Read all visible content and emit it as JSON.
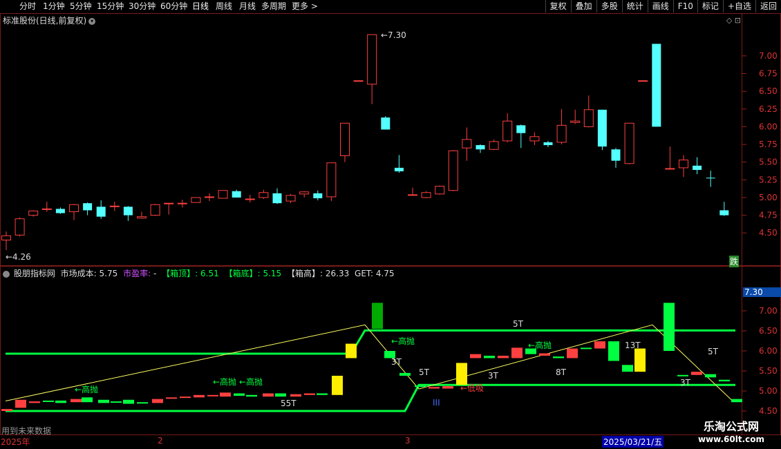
{
  "toolbar": {
    "intervals": [
      "分时",
      "1分钟",
      "5分钟",
      "15分钟",
      "30分钟",
      "60分钟",
      "日线",
      "周线",
      "月线",
      "多周期",
      "更多 >"
    ],
    "active_interval": "日线",
    "right_buttons": [
      "复权",
      "叠加",
      "多股",
      "统计",
      "画线",
      "F10",
      "标记",
      "+自选",
      "返回"
    ]
  },
  "price_panel": {
    "title": "标准股份(日线,前复权)",
    "high_marker": "7.30",
    "low_marker": "4.26",
    "fall_badge": "跌",
    "axis_ticks": [
      "7.00",
      "6.75",
      "6.50",
      "6.25",
      "6.00",
      "5.75",
      "5.50",
      "5.25",
      "5.00",
      "4.75",
      "4.50"
    ]
  },
  "indicator_panel": {
    "title_name": "股朋指标网",
    "cost_label": "市场成本:",
    "cost_value": "5.75",
    "pe_label": "市盈率:",
    "pe_value": "-",
    "top_label": "【箱顶】:",
    "top_value": "6.51",
    "bottom_label": "【箱底】:",
    "bottom_value": "5.15",
    "height_label": "【箱高】:",
    "height_value": "26.33",
    "get_label": "GET:",
    "get_value": "4.75",
    "current_price": "7.30",
    "axis_ticks": [
      "7.00",
      "6.50",
      "6.00",
      "5.50",
      "5.00",
      "4.50"
    ],
    "annotations": [
      "←高抛",
      "←高抛",
      "←高抛",
      "←高抛",
      "←高抛",
      "←低吸",
      "55T",
      "3T",
      "5T",
      "3T",
      "5T",
      "8T",
      "13T",
      "5T",
      "3T",
      "III"
    ],
    "future_note": "用到未来数据"
  },
  "date_axis": {
    "labels": [
      "2025年",
      "2",
      "3"
    ],
    "selected_date": "2025/03/21/五"
  },
  "watermark": {
    "name": "乐淘公式网",
    "url": "www.60lt.com"
  },
  "colors": {
    "up": "#ff4040",
    "down": "#54ffff",
    "indicator_green": "#00ff40",
    "yellow_line": "#ffff60",
    "frame": "#7a1a1a"
  },
  "chart_data": [
    {
      "type": "candlestick",
      "title": "标准股份(日线,前复权)",
      "y_range": [
        4.2,
        7.35
      ],
      "candles": [
        {
          "o": 4.4,
          "c": 4.46,
          "h": 4.52,
          "l": 4.26
        },
        {
          "o": 4.47,
          "c": 4.7,
          "h": 4.72,
          "l": 4.45
        },
        {
          "o": 4.75,
          "c": 4.81,
          "h": 4.82,
          "l": 4.73
        },
        {
          "o": 4.84,
          "c": 4.84,
          "h": 4.94,
          "l": 4.8
        },
        {
          "o": 4.84,
          "c": 4.78,
          "h": 4.86,
          "l": 4.77
        },
        {
          "o": 4.8,
          "c": 4.9,
          "h": 4.91,
          "l": 4.68
        },
        {
          "o": 4.92,
          "c": 4.82,
          "h": 4.93,
          "l": 4.75
        },
        {
          "o": 4.87,
          "c": 4.73,
          "h": 4.96,
          "l": 4.7
        },
        {
          "o": 4.88,
          "c": 4.88,
          "h": 4.94,
          "l": 4.81
        },
        {
          "o": 4.87,
          "c": 4.75,
          "h": 4.88,
          "l": 4.67
        },
        {
          "o": 4.71,
          "c": 4.73,
          "h": 4.8,
          "l": 4.7
        },
        {
          "o": 4.75,
          "c": 4.9,
          "h": 4.91,
          "l": 4.74
        },
        {
          "o": 4.92,
          "c": 4.92,
          "h": 4.92,
          "l": 4.76
        },
        {
          "o": 4.92,
          "c": 4.92,
          "h": 4.97,
          "l": 4.86
        },
        {
          "o": 4.93,
          "c": 5.0,
          "h": 5.0,
          "l": 4.93
        },
        {
          "o": 5.01,
          "c": 5.01,
          "h": 5.06,
          "l": 4.95
        },
        {
          "o": 4.99,
          "c": 5.1,
          "h": 5.1,
          "l": 4.99
        },
        {
          "o": 5.09,
          "c": 5.0,
          "h": 5.11,
          "l": 5.0
        },
        {
          "o": 4.98,
          "c": 4.98,
          "h": 5.04,
          "l": 4.93
        },
        {
          "o": 5.0,
          "c": 5.07,
          "h": 5.11,
          "l": 4.98
        },
        {
          "o": 5.06,
          "c": 4.92,
          "h": 5.13,
          "l": 4.91
        },
        {
          "o": 4.95,
          "c": 5.03,
          "h": 5.05,
          "l": 4.92
        },
        {
          "o": 5.05,
          "c": 5.08,
          "h": 5.09,
          "l": 5.0
        },
        {
          "o": 5.06,
          "c": 4.99,
          "h": 5.1,
          "l": 4.96
        },
        {
          "o": 5.01,
          "c": 5.49,
          "h": 5.49,
          "l": 4.95
        },
        {
          "o": 5.59,
          "c": 6.05,
          "h": 6.05,
          "l": 5.5
        },
        {
          "o": 6.65,
          "c": 6.65,
          "h": 6.65,
          "l": 6.65
        },
        {
          "o": 6.6,
          "c": 7.3,
          "h": 7.3,
          "l": 6.32
        },
        {
          "o": 6.13,
          "c": 5.96,
          "h": 6.15,
          "l": 5.96
        },
        {
          "o": 5.42,
          "c": 5.37,
          "h": 5.6,
          "l": 5.35
        },
        {
          "o": 5.04,
          "c": 5.04,
          "h": 5.14,
          "l": 5.03
        },
        {
          "o": 5.0,
          "c": 5.07,
          "h": 5.09,
          "l": 4.99
        },
        {
          "o": 5.05,
          "c": 5.16,
          "h": 5.17,
          "l": 5.04
        },
        {
          "o": 5.1,
          "c": 5.66,
          "h": 5.67,
          "l": 5.09
        },
        {
          "o": 5.7,
          "c": 5.82,
          "h": 5.99,
          "l": 5.52
        },
        {
          "o": 5.74,
          "c": 5.68,
          "h": 5.75,
          "l": 5.63
        },
        {
          "o": 5.68,
          "c": 5.79,
          "h": 5.82,
          "l": 5.67
        },
        {
          "o": 5.8,
          "c": 6.08,
          "h": 6.19,
          "l": 5.78
        },
        {
          "o": 6.02,
          "c": 5.91,
          "h": 6.03,
          "l": 5.7
        },
        {
          "o": 5.8,
          "c": 5.86,
          "h": 5.92,
          "l": 5.74
        },
        {
          "o": 5.78,
          "c": 5.74,
          "h": 5.8,
          "l": 5.71
        },
        {
          "o": 5.78,
          "c": 6.02,
          "h": 6.25,
          "l": 5.75
        },
        {
          "o": 6.06,
          "c": 6.08,
          "h": 6.24,
          "l": 6.04
        },
        {
          "o": 6.0,
          "c": 6.24,
          "h": 6.44,
          "l": 5.99
        },
        {
          "o": 6.24,
          "c": 5.72,
          "h": 6.24,
          "l": 5.67
        },
        {
          "o": 5.68,
          "c": 5.52,
          "h": 5.7,
          "l": 5.42
        },
        {
          "o": 5.48,
          "c": 6.05,
          "h": 6.05,
          "l": 5.47
        },
        {
          "o": 6.65,
          "c": 6.65,
          "h": 6.65,
          "l": 6.65
        },
        {
          "o": 7.17,
          "c": 6.0,
          "h": 7.17,
          "l": 6.0
        },
        {
          "o": 5.41,
          "c": 5.41,
          "h": 5.72,
          "l": 5.4
        },
        {
          "o": 5.42,
          "c": 5.53,
          "h": 5.6,
          "l": 5.29
        },
        {
          "o": 5.45,
          "c": 5.39,
          "h": 5.57,
          "l": 5.33
        },
        {
          "o": 5.28,
          "c": 5.27,
          "h": 5.38,
          "l": 5.15
        },
        {
          "o": 4.82,
          "c": 4.75,
          "h": 4.94,
          "l": 4.74
        }
      ]
    },
    {
      "type": "line",
      "title": "股朋指标网",
      "y_range": [
        4.45,
        7.45
      ],
      "series": [
        {
          "name": "箱顶",
          "values": [
            5.93,
            6.51
          ]
        },
        {
          "name": "箱底",
          "values": [
            4.5,
            5.15
          ]
        },
        {
          "name": "市场成本",
          "values": [
            4.75,
            6.65,
            6.65,
            4.75
          ]
        }
      ]
    }
  ]
}
